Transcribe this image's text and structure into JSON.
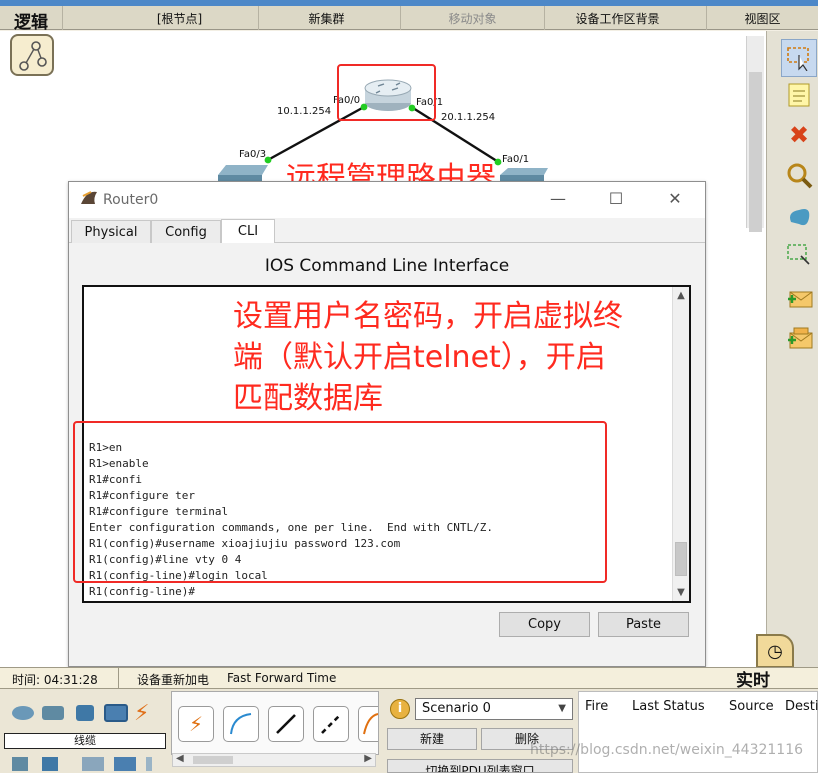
{
  "toolbar": {
    "logic_label": "逻辑",
    "root_node": "[根节点]",
    "new_cluster": "新集群",
    "move_object": "移动对象",
    "set_workspace_bg": "设备工作区背景",
    "view_area": "视图区"
  },
  "network": {
    "router_port_left": "Fa0/0",
    "router_port_right": "Fa0/1",
    "ip_left": "10.1.1.254",
    "ip_right": "20.1.1.254",
    "switch_left_port": "Fa0/3",
    "switch_right_port": "Fa0/1"
  },
  "annotations": {
    "remote_manage": "远程管理路由器",
    "config_note_lines": [
      "设置用户名密码，开启虚拟终",
      "端（默认开启telnet），开启",
      "匹配数据库"
    ]
  },
  "router_window": {
    "title": "Router0",
    "tabs": [
      "Physical",
      "Config",
      "CLI"
    ],
    "active_tab": "CLI",
    "cli_heading": "IOS Command Line Interface",
    "terminal_lines": [
      "R1>en",
      "R1>enable",
      "R1#confi",
      "R1#configure ter",
      "R1#configure terminal",
      "Enter configuration commands, one per line.  End with CNTL/Z.",
      "R1(config)#username xioajiujiu password 123.com",
      "R1(config)#line vty 0 4",
      "R1(config-line)#login local",
      "R1(config-line)#"
    ],
    "copy_label": "Copy",
    "paste_label": "Paste"
  },
  "status_bar": {
    "time_label": "时间: 04:31:28",
    "power_cycle": "设备重新加电",
    "fast_forward": "Fast Forward Time",
    "realtime": "实时"
  },
  "bottom_panel": {
    "cable_label": "线缆",
    "scenario": "Scenario 0",
    "new_button": "新建",
    "delete_button": "删除",
    "switch_pdu_list": "切换到PDU列表窗口",
    "pdu_columns": [
      "Fire",
      "Last Status",
      "Source",
      "Desti"
    ]
  },
  "watermark": "https://blog.csdn.net/weixin_44321116",
  "colors": {
    "annotation_red": "#ff2a1f",
    "link_up_green": "#22cc22",
    "title_stripe": "#4d88c8"
  }
}
